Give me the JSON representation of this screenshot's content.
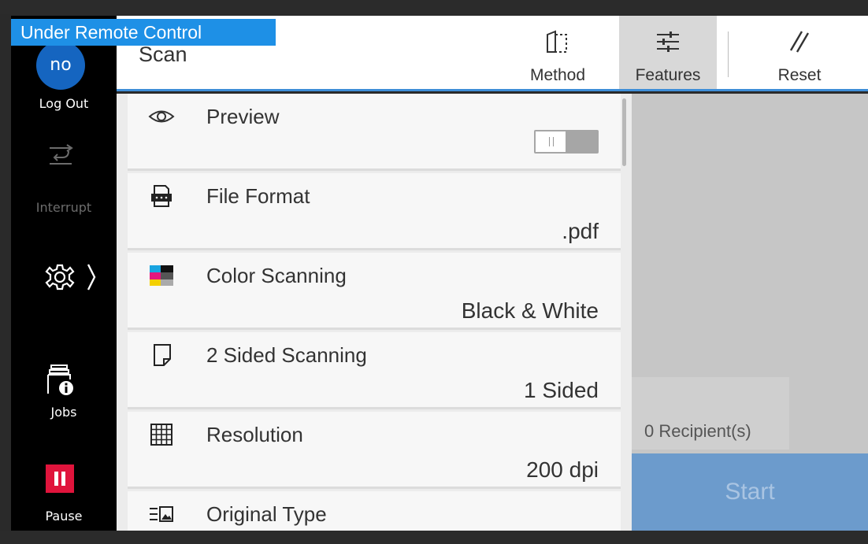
{
  "banner": {
    "text": "Under Remote Control"
  },
  "rail": {
    "user_initials": "no",
    "logout_label": "Log Out",
    "interrupt_label": "Interrupt",
    "jobs_label": "Jobs",
    "pause_label": "Pause"
  },
  "header": {
    "title": "Scan",
    "method_label": "Method",
    "features_label": "Features",
    "reset_label": "Reset"
  },
  "features": [
    {
      "icon": "eye-icon",
      "title": "Preview",
      "value": "",
      "toggle": "off"
    },
    {
      "icon": "file-format-icon",
      "title": "File Format",
      "value": ".pdf"
    },
    {
      "icon": "color-icon",
      "title": "Color Scanning",
      "value": "Black & White"
    },
    {
      "icon": "page-icon",
      "title": "2 Sided Scanning",
      "value": "1 Sided"
    },
    {
      "icon": "grid-icon",
      "title": "Resolution",
      "value": "200 dpi"
    },
    {
      "icon": "original-type-icon",
      "title": "Original Type",
      "value": ""
    }
  ],
  "right": {
    "recipients": "0 Recipient(s)",
    "start_label": "Start"
  },
  "colors": {
    "banner": "#1e90e6",
    "avatar": "#1565c0",
    "pause": "#e0143c",
    "start": "#6c9bcc"
  }
}
